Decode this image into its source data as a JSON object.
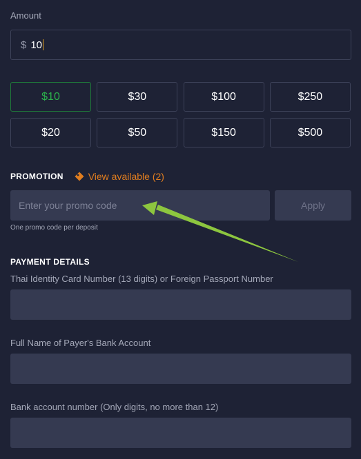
{
  "amount": {
    "label": "Amount",
    "currency_symbol": "$",
    "value": "10"
  },
  "presets": [
    {
      "label": "$10",
      "active": true
    },
    {
      "label": "$30",
      "active": false
    },
    {
      "label": "$100",
      "active": false
    },
    {
      "label": "$250",
      "active": false
    },
    {
      "label": "$20",
      "active": false
    },
    {
      "label": "$50",
      "active": false
    },
    {
      "label": "$150",
      "active": false
    },
    {
      "label": "$500",
      "active": false
    }
  ],
  "promotion": {
    "title": "PROMOTION",
    "view_available": "View available (2)",
    "icon": "tag-icon",
    "placeholder": "Enter your promo code",
    "apply_label": "Apply",
    "hint": "One promo code per deposit"
  },
  "payment": {
    "title": "PAYMENT DETAILS",
    "fields": [
      {
        "label": "Thai Identity Card Number (13 digits) or Foreign Passport Number",
        "value": ""
      },
      {
        "label": "Full Name of Payer's Bank Account",
        "value": ""
      },
      {
        "label": "Bank account number (Only digits, no more than 12)",
        "value": ""
      }
    ]
  },
  "colors": {
    "background": "#1e2235",
    "field_bg": "#353a51",
    "accent_green": "#2bb24c",
    "accent_orange": "#e07d1f",
    "annotation_arrow": "#8dc63f"
  }
}
